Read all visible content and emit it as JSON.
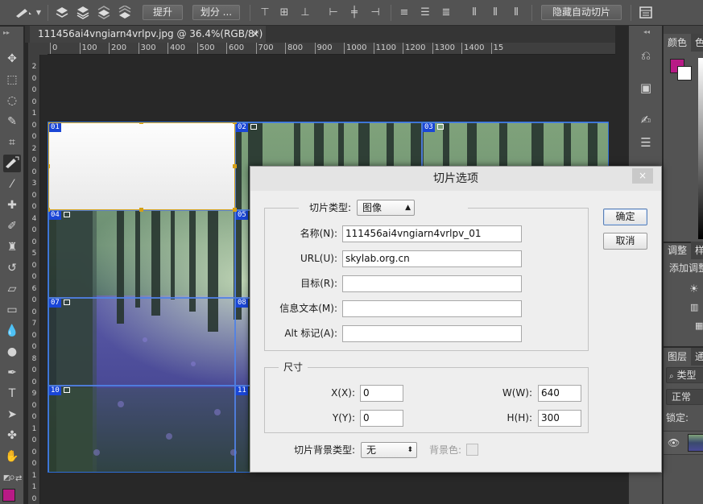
{
  "options_bar": {
    "promote_label": "提升",
    "divide_label": "划分 ...",
    "hide_auto_slices_label": "隐藏自动切片"
  },
  "document": {
    "tab_title": "111456ai4vngiarn4vrlpv.jpg @ 36.4%(RGB/8*)",
    "tab_close": "×"
  },
  "ruler": {
    "h_ticks": [
      "0",
      "100",
      "200",
      "300",
      "400",
      "500",
      "600",
      "700",
      "800",
      "900",
      "1000",
      "1100",
      "1200",
      "1300",
      "1400",
      "15"
    ],
    "v_ticks": [
      "2",
      "0",
      "0",
      "0",
      "1",
      "0",
      "0",
      "2",
      "0",
      "0",
      "3",
      "0",
      "0",
      "4",
      "0",
      "0",
      "5",
      "0",
      "0",
      "6",
      "0",
      "0",
      "7",
      "0",
      "0",
      "8",
      "0",
      "0",
      "9",
      "0",
      "0",
      "1",
      "0",
      "0",
      "0",
      "1",
      "1",
      "0"
    ]
  },
  "slices": {
    "labels": [
      "01",
      "02",
      "03",
      "04",
      "05",
      "07",
      "08",
      "10",
      "11"
    ]
  },
  "right_panel": {
    "color_tab": "颜色",
    "color_tab2": "色",
    "adjust_tab": "调整",
    "adjust_tab2": "样",
    "adjust_hint": "添加调整",
    "layers_tab": "图层",
    "layers_tab2": "通",
    "search_kind": "类型",
    "blend_mode": "正常",
    "lock_label": "锁定:"
  },
  "colors": {
    "foreground": "#b81a86",
    "background": "#ffffff",
    "slice_label_bg": "#1a46d6",
    "selected_slice": "#d4a017"
  },
  "dialog": {
    "title": "切片选项",
    "close": "×",
    "slice_type_label": "切片类型:",
    "slice_type_value": "图像",
    "name_label": "名称(N):",
    "name_value": "111456ai4vngiarn4vrlpv_01",
    "url_label": "URL(U):",
    "url_value": "skylab.org.cn",
    "target_label": "目标(R):",
    "target_value": "",
    "message_label": "信息文本(M):",
    "message_value": "",
    "alt_label": "Alt 标记(A):",
    "alt_value": "",
    "size_group": "尺寸",
    "x_label": "X(X):",
    "x_value": "0",
    "y_label": "Y(Y):",
    "y_value": "0",
    "w_label": "W(W):",
    "w_value": "640",
    "h_label": "H(H):",
    "h_value": "300",
    "bg_type_label": "切片背景类型:",
    "bg_type_value": "无",
    "bg_color_label": "背景色:",
    "ok_label": "确定",
    "cancel_label": "取消"
  }
}
